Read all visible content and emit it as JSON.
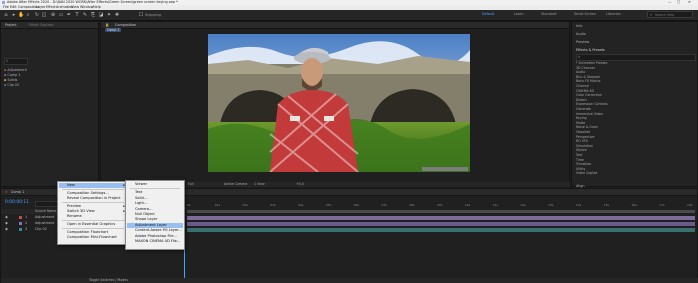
{
  "window": {
    "title": "Adobe After Effects 2020 - D:\\BAN 2020 WORK\\After Effects\\Green Screen\\green screen keying.aep *",
    "controls": [
      "—",
      "□",
      "✕"
    ]
  },
  "menu": [
    "File",
    "Edit",
    "Composition",
    "Layer",
    "Effect",
    "Animation",
    "View",
    "Window",
    "Help"
  ],
  "toolbar": {
    "snapping_label": "Snapping",
    "workspaces": [
      "Default",
      "Learn",
      "Standard",
      "Small Screen",
      "Libraries"
    ],
    "active_workspace": "Default",
    "search_placeholder": "Search Help"
  },
  "project_panel": {
    "tab": "Project",
    "effect_controls_tab": "Effect Controls",
    "search_placeholder": "",
    "items": [
      "Adjustment",
      "Comp 1",
      "Solids",
      "Clip 02"
    ]
  },
  "composition_panel": {
    "tab": "Composition",
    "comp_tab": "Comp 1",
    "zoom": "Full",
    "camera": "Active Camera",
    "views": "1 View",
    "timecode_label": "+0.0"
  },
  "right_panel": {
    "sections": [
      "Info",
      "Audio",
      "Preview",
      "Effects & Presets"
    ],
    "search_placeholder": "",
    "effect_categories": [
      "* Animation Presets",
      "3D Channel",
      "Audio",
      "Blur & Sharpen",
      "Boris FX Mocha",
      "Channel",
      "CINEMA 4D",
      "Color Correction",
      "Distort",
      "Expression Controls",
      "Generate",
      "Immersive Video",
      "Keying",
      "Matte",
      "Noise & Grain",
      "Obsolete",
      "Perspective",
      "RG VFX",
      "Simulation",
      "Stylize",
      "Text",
      "Time",
      "Transition",
      "Utility",
      "Video Copilot"
    ],
    "align_label": "Align"
  },
  "timeline": {
    "tab": "Comp 1",
    "timecode": "0:00:00:11",
    "search_placeholder": "",
    "column_label": "Source Name",
    "layers": [
      {
        "num": "1",
        "name": "Adjustment"
      },
      {
        "num": "2",
        "name": "Adjustment"
      },
      {
        "num": "3",
        "name": "Clip 02"
      }
    ],
    "ruler_ticks": [
      "0s",
      "01s",
      "02s",
      "03s",
      "04s",
      "05s",
      "06s",
      "07s",
      "08s",
      "09s",
      "10s",
      "11s",
      "12s",
      "13s",
      "14s",
      "15s",
      "16s",
      "17s",
      "18s"
    ],
    "footer": "Toggle Switches / Modes"
  },
  "context_menu": {
    "items": [
      {
        "label": "New",
        "submenu": true,
        "highlight": true
      },
      {
        "sep": true
      },
      {
        "label": "Composition Settings..."
      },
      {
        "label": "Reveal Composition in Project"
      },
      {
        "sep": true
      },
      {
        "label": "Preview",
        "submenu": true
      },
      {
        "label": "Switch 3D View",
        "submenu": true
      },
      {
        "label": "Rename"
      },
      {
        "sep": true
      },
      {
        "label": "Open in Essential Graphics"
      },
      {
        "sep": true
      },
      {
        "label": "Composition Flowchart"
      },
      {
        "label": "Composition Mini-Flowchart"
      }
    ]
  },
  "submenu": {
    "items": [
      {
        "label": "Viewer"
      },
      {
        "sep": true
      },
      {
        "label": "Text"
      },
      {
        "label": "Solid..."
      },
      {
        "label": "Light..."
      },
      {
        "label": "Camera..."
      },
      {
        "label": "Null Object"
      },
      {
        "label": "Shape Layer"
      },
      {
        "label": "Adjustment Layer",
        "highlight": true
      },
      {
        "label": "Content-Aware Fill Layer..."
      },
      {
        "label": "Adobe Photoshop File..."
      },
      {
        "label": "MAXON CINEMA 4D File..."
      }
    ]
  },
  "colors": {
    "accent": "#4aa3ff",
    "menu_highlight": "#99bff0",
    "layer_label_red": "#c94b4b",
    "layer_label_purple": "#8a6fc9",
    "layer_label_teal": "#3a8c8c"
  }
}
